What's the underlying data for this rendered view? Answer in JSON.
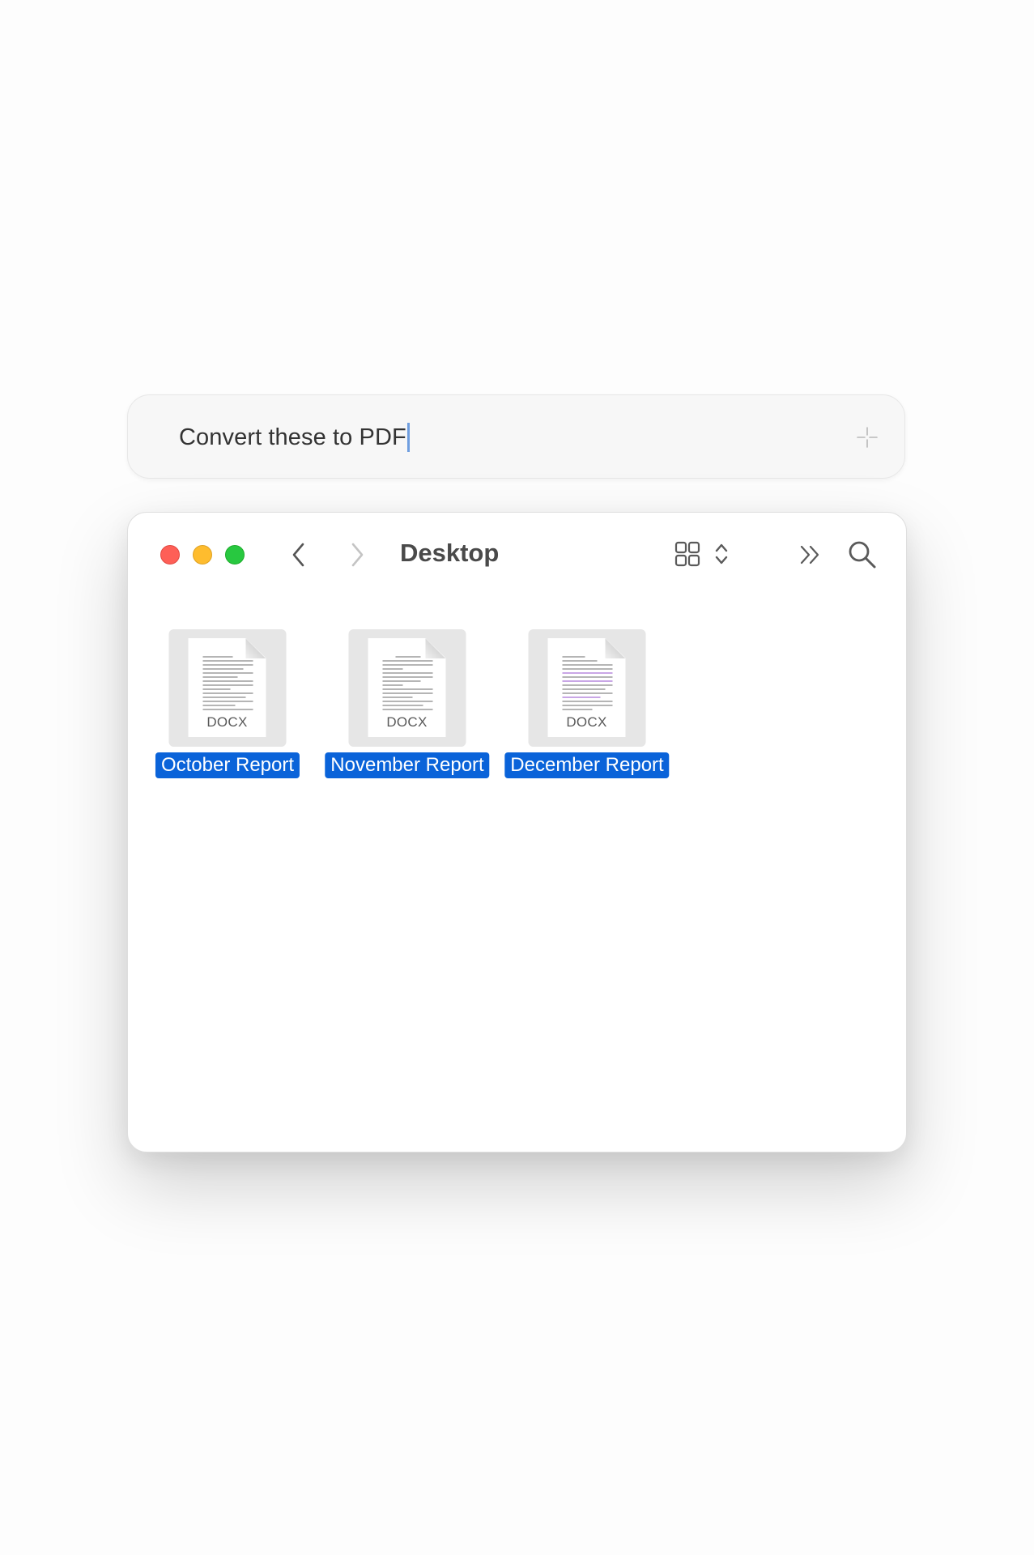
{
  "prompt": {
    "text": "Convert these to PDF"
  },
  "window": {
    "title": "Desktop"
  },
  "files": [
    {
      "name": "October Report",
      "type": "DOCX"
    },
    {
      "name": "November Report",
      "type": "DOCX"
    },
    {
      "name": "December Report",
      "type": "DOCX"
    }
  ],
  "colors": {
    "selection": "#0a63d9",
    "close": "#fe5f57",
    "minimize": "#febc2e",
    "zoom": "#28c840"
  },
  "icons": {
    "prompt": [
      "sparkle-icon"
    ],
    "toolbar": [
      "chevron-left-icon",
      "chevron-right-icon",
      "grid-view-icon",
      "up-down-chevron-icon",
      "double-chevron-right-icon",
      "search-icon"
    ]
  }
}
